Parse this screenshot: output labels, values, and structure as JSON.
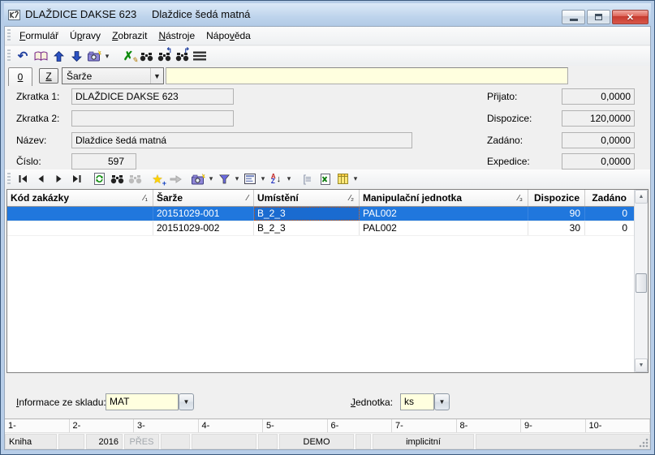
{
  "window": {
    "title": "DLAŽDICE DAKSE 623",
    "subtitle": "Dlaždice šedá matná"
  },
  "menu": {
    "items": [
      {
        "pre": "",
        "accel": "F",
        "post": "ormulář"
      },
      {
        "pre": "Ú",
        "accel": "p",
        "post": "ravy"
      },
      {
        "pre": "",
        "accel": "Z",
        "post": "obrazit"
      },
      {
        "pre": "",
        "accel": "N",
        "post": "ástroje"
      },
      {
        "pre": "Nápo",
        "accel": "v",
        "post": "ěda"
      }
    ]
  },
  "toolbar_icons": [
    "undo-icon",
    "book-icon",
    "arrow-up-icon",
    "arrow-down-icon",
    "camera-icon",
    "dropdown-icon",
    "edit-confirm-icon",
    "binoculars-icon",
    "find-previous-icon",
    "find-next-icon",
    "menu-lines-icon"
  ],
  "grid_toolbar_icons": [
    "first-record-icon",
    "previous-record-icon",
    "next-record-icon",
    "last-record-icon",
    "refresh-icon",
    "find-icon",
    "find-next-disabled-icon",
    "insert-record-icon",
    "copy-record-disabled-icon",
    "camera-icon",
    "filter-icon",
    "form-view-icon",
    "sort-icon",
    "group-icon",
    "excel-export-icon",
    "columns-icon"
  ],
  "filter": {
    "tab_label": "0",
    "z_button_label": "Z",
    "selector_value": "Šarže",
    "search_value": ""
  },
  "form": {
    "fields_left": [
      {
        "label": "Zkratka 1:",
        "value": "DLAŽDICE DAKSE 623"
      },
      {
        "label": "Zkratka 2:",
        "value": ""
      },
      {
        "label": "Název:",
        "value": "Dlaždice šedá matná"
      },
      {
        "label": "Číslo:",
        "value": "597"
      }
    ],
    "fields_right": [
      {
        "label": "Přijato:",
        "value": "0,0000"
      },
      {
        "label": "Dispozice:",
        "value": "120,0000"
      },
      {
        "label": "Zadáno:",
        "value": "0,0000"
      },
      {
        "label": "Expedice:",
        "value": "0,0000"
      }
    ]
  },
  "grid": {
    "columns": [
      {
        "label": "Kód zakázky",
        "sort_mark": "∕₁"
      },
      {
        "label": "Šarže",
        "sort_mark": "∕"
      },
      {
        "label": "Umístění",
        "sort_mark": "∕₂"
      },
      {
        "label": "Manipulační jednotka",
        "sort_mark": "∕₃"
      },
      {
        "label": "Dispozice",
        "sort_mark": ""
      },
      {
        "label": "Zadáno",
        "sort_mark": ""
      }
    ],
    "rows": [
      {
        "cells": [
          "",
          "20151029-001",
          "B_2_3",
          "PAL002",
          "90",
          "0"
        ],
        "selected": true
      },
      {
        "cells": [
          "",
          "20151029-002",
          "B_2_3",
          "PAL002",
          "30",
          "0"
        ],
        "selected": false
      }
    ]
  },
  "footer": {
    "info_label_pre": "",
    "info_label_accel": "I",
    "info_label_post": "nformace ze skladu:",
    "info_value": "MAT",
    "unit_label_pre": "",
    "unit_label_accel": "J",
    "unit_label_post": "ednotka:",
    "unit_value": "ks"
  },
  "statusbar": {
    "sections": [
      "1-",
      "2-",
      "3-",
      "4-",
      "5-",
      "6-",
      "7-",
      "8-",
      "9-",
      "10-"
    ],
    "cells": [
      "Kniha",
      "",
      "2016",
      "PŘES",
      "",
      "",
      "",
      "DEMO",
      "",
      "implicitní",
      ""
    ]
  },
  "colors": {
    "selection_blue": "#2077dd",
    "field_yellow": "#ffffdf",
    "close_button_red": "#c63b2f"
  }
}
